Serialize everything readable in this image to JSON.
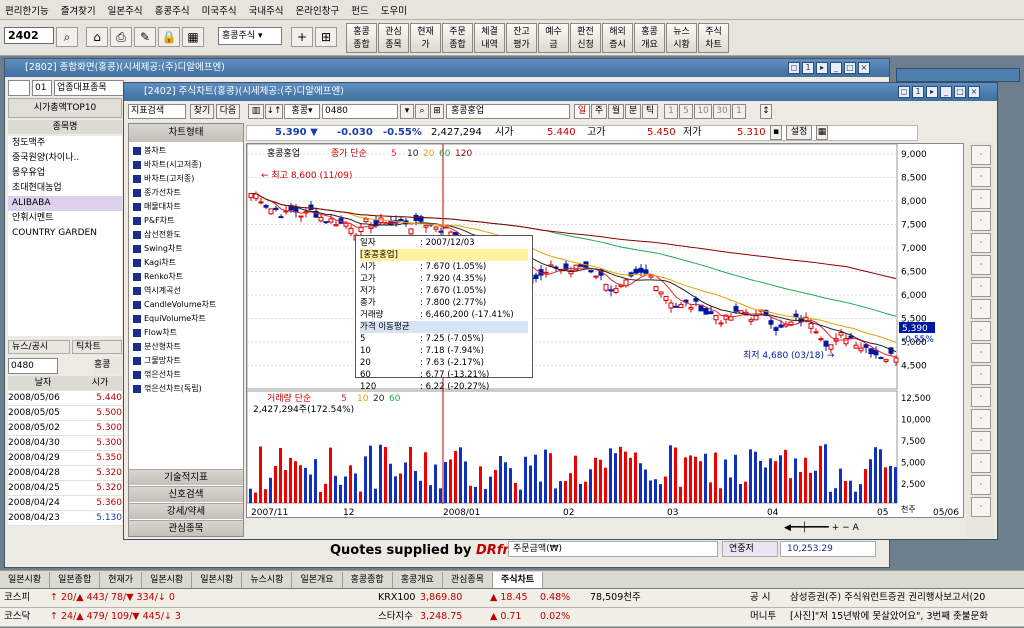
{
  "menu": [
    "편리한기능",
    "즐겨찾기",
    "일본주식",
    "홍콩주식",
    "미국주식",
    "국내주식",
    "온라인창구",
    "펀드",
    "도우미"
  ],
  "toolbar": {
    "code": "2402",
    "combo": "홍콩주식",
    "buttons": [
      "홍콩\n종합",
      "관심\n종목",
      "현재\n가",
      "주문\n종합",
      "체결\n내역",
      "잔고\n평가",
      "예수\n금",
      "환전\n신청",
      "해외\n증시",
      "홍콩\n개요",
      "뉴스\n시황",
      "주식\n차트"
    ]
  },
  "bgwin": {
    "title": "[2802] 종합화면(홍콩)(시세제공:(주)디알에프엔)",
    "code": "01",
    "combo": "업종대표종목",
    "tab": "시가총액TOP10",
    "col_header": "종목명",
    "stocks": [
      "청도맥주",
      "중국원양(차이나..",
      "몽우유업",
      "초대현대농업",
      "ALIBABA",
      "안휘시멘트",
      "COUNTRY GARDEN"
    ],
    "news_tab": "뉴스/공시",
    "tick_tab": "틱차트",
    "code2": "0480",
    "hk_label": "홍콩",
    "tbl_head": [
      "날자",
      "시가"
    ],
    "rows": [
      [
        "2008/05/06",
        "5.440"
      ],
      [
        "2008/05/05",
        "5.500"
      ],
      [
        "2008/05/02",
        "5.300"
      ],
      [
        "2008/04/30",
        "5.300"
      ],
      [
        "2008/04/29",
        "5.350"
      ],
      [
        "2008/04/28",
        "5.320"
      ],
      [
        "2008/04/25",
        "5.320"
      ],
      [
        "2008/04/24",
        "5.360"
      ],
      [
        "2008/04/23",
        "5.130"
      ]
    ],
    "quotes": "Quotes supplied by",
    "drfn": "DRfn",
    "order_amount": "주문금액(₩)",
    "linked_label": "연중저",
    "linked_val": "10,253.29"
  },
  "chartwin": {
    "title": "[2402] 주식차트(홍콩)(시세제공:(주)디알에프엔)",
    "search": "지표검색",
    "find": "찾기",
    "next": "다음",
    "market": "홍콩",
    "code": "0480",
    "stock": "홍콩홍업",
    "periods": [
      "일",
      "주",
      "월",
      "분",
      "틱"
    ],
    "nums": [
      "1",
      "5",
      "10",
      "30",
      "1"
    ],
    "setting": "설정"
  },
  "quote": {
    "price": "5.390 ▼",
    "chg": "-0.030",
    "pct": "-0.55%",
    "vol": "2,427,294",
    "open_l": "시가",
    "open": "5.440",
    "high_l": "고가",
    "high": "5.450",
    "low_l": "저가",
    "low": "5.310"
  },
  "side": {
    "header": "차트형태",
    "items": [
      "봉차트",
      "바차트(시고저종)",
      "바차트(고저종)",
      "종가선차트",
      "매물대차트",
      "P&F차트",
      "삼선전환도",
      "Swing차트",
      "Kagi차트",
      "Renko차트",
      "역시계곡선",
      "CandleVolume차트",
      "EquiVolume차트",
      "Flow차트",
      "분산형차트",
      "그물망차트",
      "꺾은선차트",
      "꺾은선차트(독립)"
    ],
    "buttons": [
      "기술적지표",
      "신호검색",
      "강세/약세",
      "관심종목"
    ]
  },
  "chart": {
    "legend_name": "홍콩홍업",
    "legend_ma": "종가 단순",
    "mas": [
      "5",
      "10",
      "20",
      "60",
      "120"
    ],
    "max_label": "최고 8,600 (11/09)",
    "min_label": "최저 4,680 (03/18)",
    "yaxis": [
      "9,000",
      "8,500",
      "8,000",
      "7,500",
      "7,000",
      "6,500",
      "6,000",
      "5,500",
      "5,000",
      "4,500"
    ],
    "price_tag": "5,390",
    "pct_tag": "-0.55%",
    "vol_legend": "거래량 단순",
    "vol_mas": [
      "5",
      "10",
      "20",
      "60"
    ],
    "vol_now": "2,427,294주(172.54%)",
    "vol_axis": [
      "12,500",
      "10,000",
      "7,500",
      "5,000",
      "2,500"
    ],
    "vol_unit": "천주",
    "xaxis": [
      "2007/11",
      "12",
      "2008/01",
      "02",
      "03",
      "04",
      "05",
      "05/06"
    ]
  },
  "tooltip": {
    "rows": [
      [
        "일자",
        ": 2007/12/03"
      ],
      [
        "[홍콩홍업]",
        ""
      ],
      [
        "시가",
        ": 7.670 (1.05%)"
      ],
      [
        "고가",
        ": 7.920 (4.35%)"
      ],
      [
        "저가",
        ": 7.670 (1.05%)"
      ],
      [
        "종가",
        ": 7.800 (2.77%)"
      ],
      [
        "거래량",
        ": 6,460,200 (-17.41%)"
      ],
      [
        "가격 이동평균",
        ""
      ],
      [
        "5",
        ": 7.25 (-7.05%)"
      ],
      [
        "10",
        ": 7.18 (-7.94%)"
      ],
      [
        "20",
        ": 7.63 (-2.17%)"
      ],
      [
        "60",
        ": 6.77 (-13.21%)"
      ],
      [
        "120",
        ": 6.22 (-20.27%)"
      ]
    ]
  },
  "tasks": [
    "일본시황",
    "일본종합",
    "현재가",
    "일본시황",
    "일본시황",
    "뉴스시황",
    "일본개요",
    "홍콩종합",
    "홍콩개요",
    "관심종목",
    "주식차트"
  ],
  "tickers": [
    {
      "name": "코스피",
      "vals": "↑ 20/▲ 443/ 78/▼ 334/↓ 0",
      "idx": "KRX100",
      "v1": "3,869.80",
      "v2": "▲ 18.45",
      "v3": "0.48%",
      "v4": "78,509천주",
      "tag": "공 시",
      "news": "삼성증권(주) 주식워런트증권 권리행사보고서(20"
    },
    {
      "name": "코스닥",
      "vals": "↑ 24/▲ 479/ 109/▼ 445/↓ 3",
      "idx": "스타지수",
      "v1": "3,248.75",
      "v2": "▲ 0.71",
      "v3": "0.02%",
      "v4": "",
      "tag": "머니투",
      "news": "[사진]\"저 15년밖에 못살았어요\", 3번째 촛불문화"
    }
  ]
}
